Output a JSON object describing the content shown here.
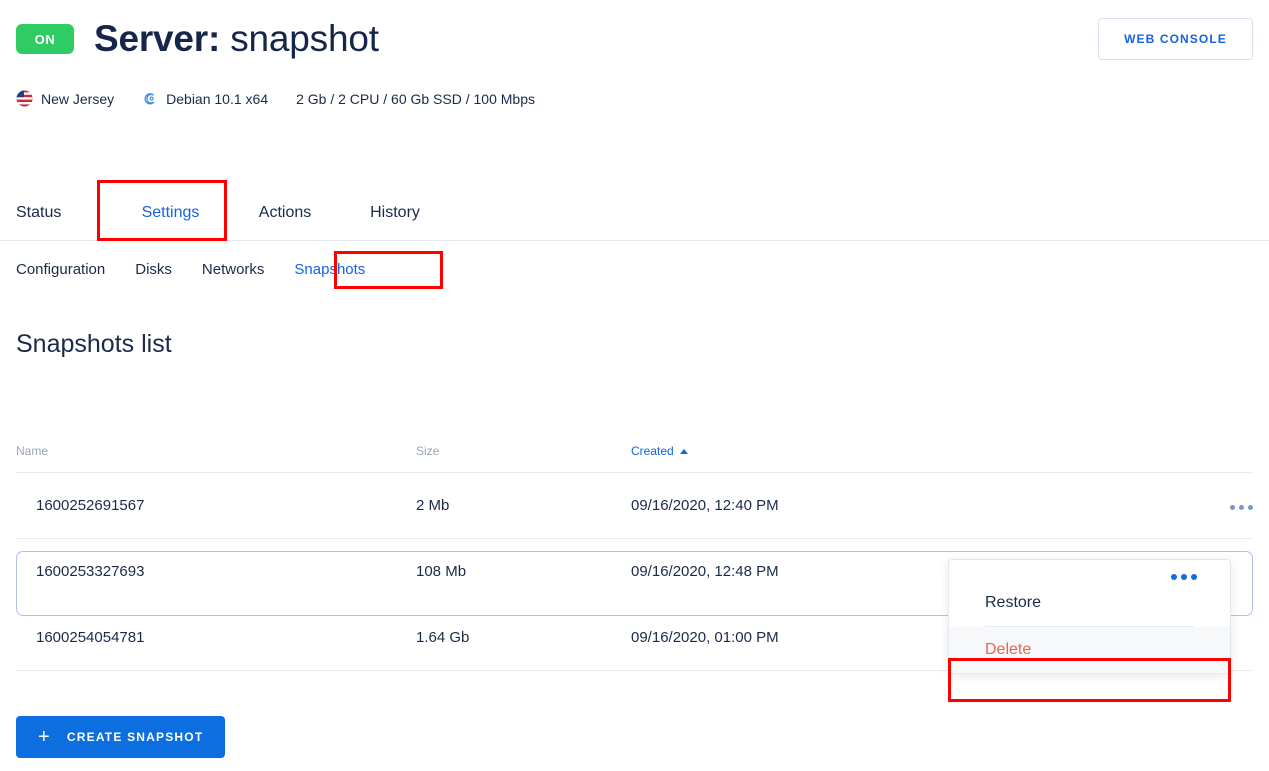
{
  "header": {
    "power_badge": "ON",
    "title_label": "Server:",
    "title_name": "snapshot",
    "web_console_label": "WEB CONSOLE"
  },
  "meta": {
    "location_icon": "us-flag-icon",
    "location": "New Jersey",
    "os_icon": "debian-logo-icon",
    "os": "Debian 10.1 x64",
    "specs": "2 Gb / 2 CPU / 60 Gb SSD / 100 Mbps"
  },
  "tabs_primary": [
    {
      "label": "Status",
      "active": false
    },
    {
      "label": "Settings",
      "active": true
    },
    {
      "label": "Actions",
      "active": false
    },
    {
      "label": "History",
      "active": false
    }
  ],
  "tabs_secondary": [
    {
      "label": "Configuration",
      "active": false
    },
    {
      "label": "Disks",
      "active": false
    },
    {
      "label": "Networks",
      "active": false
    },
    {
      "label": "Snapshots",
      "active": true
    }
  ],
  "section": {
    "title": "Snapshots list"
  },
  "table": {
    "columns": [
      {
        "label": "Name",
        "sorted": false
      },
      {
        "label": "Size",
        "sorted": false
      },
      {
        "label": "Created",
        "sorted": true,
        "sort_direction": "asc"
      },
      {
        "label": "",
        "sorted": false
      }
    ],
    "rows": [
      {
        "name": "1600252691567",
        "size": "2 Mb",
        "created": "09/16/2020, 12:40 PM",
        "menu_icon": "more-options-icon",
        "selected": false
      },
      {
        "name": "1600253327693",
        "size": "108 Mb",
        "created": "09/16/2020, 12:48 PM",
        "menu_icon": "more-options-icon",
        "selected": true
      },
      {
        "name": "1600254054781",
        "size": "1.64 Gb",
        "created": "09/16/2020, 01:00 PM",
        "menu_icon": "more-options-icon",
        "selected": false
      }
    ]
  },
  "dropdown": {
    "toggle_icon": "more-options-icon",
    "items": [
      {
        "label": "Restore",
        "danger": false
      },
      {
        "label": "Delete",
        "danger": true
      }
    ]
  },
  "actions": {
    "create_icon": "plus-icon",
    "create_label": "CREATE SNAPSHOT"
  },
  "colors": {
    "accent_blue": "#0d6ee0",
    "link_blue": "#1463e0",
    "status_green": "#2ecc63",
    "danger_red": "#ee6352",
    "annotation_red": "#ff0000",
    "text_dark": "#1b2a4a",
    "muted": "#9aa4b5"
  }
}
